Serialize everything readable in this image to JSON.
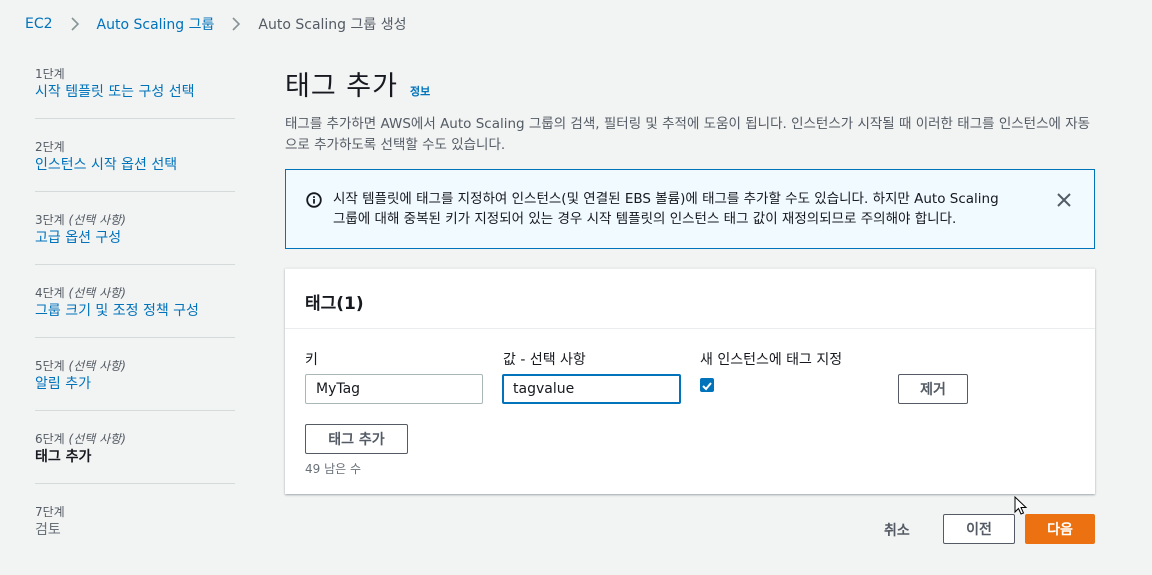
{
  "breadcrumb": {
    "items": [
      "EC2",
      "Auto Scaling 그룹"
    ],
    "current": "Auto Scaling 그룹 생성"
  },
  "steps": [
    {
      "num": "1단계",
      "optional": "",
      "title": "시작 템플릿 또는 구성 선택"
    },
    {
      "num": "2단계",
      "optional": "",
      "title": "인스턴스 시작 옵션 선택"
    },
    {
      "num": "3단계",
      "optional": "(선택 사항)",
      "title": "고급 옵션 구성"
    },
    {
      "num": "4단계",
      "optional": "(선택 사항)",
      "title": "그룹 크기 및 조정 정책 구성"
    },
    {
      "num": "5단계",
      "optional": "(선택 사항)",
      "title": "알림 추가"
    },
    {
      "num": "6단계",
      "optional": "(선택 사항)",
      "title": "태그 추가"
    },
    {
      "num": "7단계",
      "optional": "",
      "title": "검토"
    }
  ],
  "page": {
    "title": "태그 추가",
    "info_link": "정보",
    "description": "태그를 추가하면 AWS에서 Auto Scaling 그룹의 검색, 필터링 및 추적에 도움이 됩니다. 인스턴스가 시작될 때 이러한 태그를 인스턴스에 자동으로 추가하도록 선택할 수도 있습니다."
  },
  "alert": {
    "line1": "시작 템플릿에 태그를 지정하여 인스턴스(및 연결된 EBS 볼륨)에 태그를 추가할 수도 있습니다. 하지만 Auto Scaling",
    "line2": "그룹에 대해 중복된 키가 지정되어 있는 경우 시작 템플릿의 인스턴스 태그 값이 재정의되므로 주의해야 합니다."
  },
  "tags_panel": {
    "title": "태그(1)",
    "key_label": "키",
    "value_label": "값 - 선택 사항",
    "propagate_label": "새 인스턴스에 태그 지정",
    "key_value": "MyTag",
    "tag_value": "tagvalue",
    "propagate_checked": true,
    "remove_button": "제거",
    "add_button": "태그 추가",
    "remaining": "49 남은 수"
  },
  "footer": {
    "cancel": "취소",
    "previous": "이전",
    "next": "다음"
  },
  "colors": {
    "link": "#0073bb",
    "primary_button": "#ec7211",
    "alert_bg": "#f1faff"
  }
}
